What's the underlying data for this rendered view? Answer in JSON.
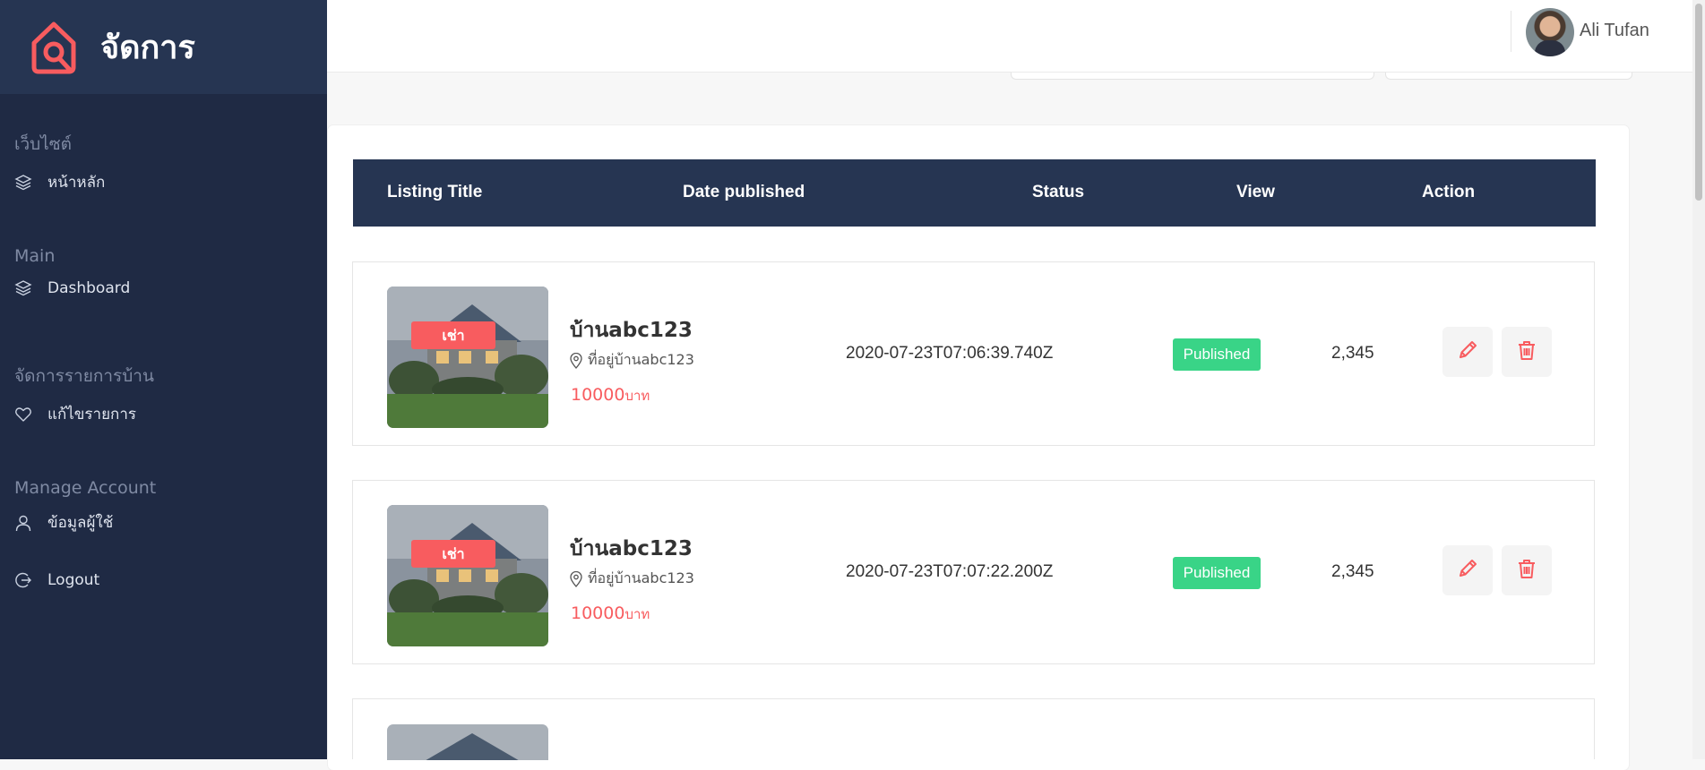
{
  "brand": {
    "name": "จัดการ"
  },
  "sidebar": {
    "sections": [
      {
        "heading": "เว็บไซต์",
        "items": [
          {
            "label": "หน้าหลัก",
            "icon": "layers-icon"
          }
        ]
      },
      {
        "heading": "Main",
        "items": [
          {
            "label": "Dashboard",
            "icon": "layers-icon"
          }
        ]
      },
      {
        "heading": "จัดการรายการบ้าน",
        "items": [
          {
            "label": "แก้ไขรายการ",
            "icon": "heart-icon"
          }
        ]
      },
      {
        "heading": "Manage Account",
        "items": [
          {
            "label": "ข้อมูลผู้ใช้",
            "icon": "user-icon"
          },
          {
            "label": "Logout",
            "icon": "logout-icon"
          }
        ]
      }
    ]
  },
  "header": {
    "user_name": "Ali Tufan"
  },
  "table": {
    "columns": [
      "Listing Title",
      "Date published",
      "Status",
      "View",
      "Action"
    ],
    "rows": [
      {
        "tag": "เช่า",
        "title": "บ้านabc123",
        "address": "ที่อยู่บ้านabc123",
        "price": "10000",
        "currency": "บาท",
        "date": "2020-07-23T07:06:39.740Z",
        "status": "Published",
        "views": "2,345"
      },
      {
        "tag": "เช่า",
        "title": "บ้านabc123",
        "address": "ที่อยู่บ้านabc123",
        "price": "10000",
        "currency": "บาท",
        "date": "2020-07-23T07:07:22.200Z",
        "status": "Published",
        "views": "2,345"
      }
    ]
  },
  "colors": {
    "sidebar_bg": "#1f2a44",
    "brand_bg": "#263552",
    "accent": "#f85c5f",
    "status_published": "#39d487",
    "table_header_bg": "#263552"
  }
}
